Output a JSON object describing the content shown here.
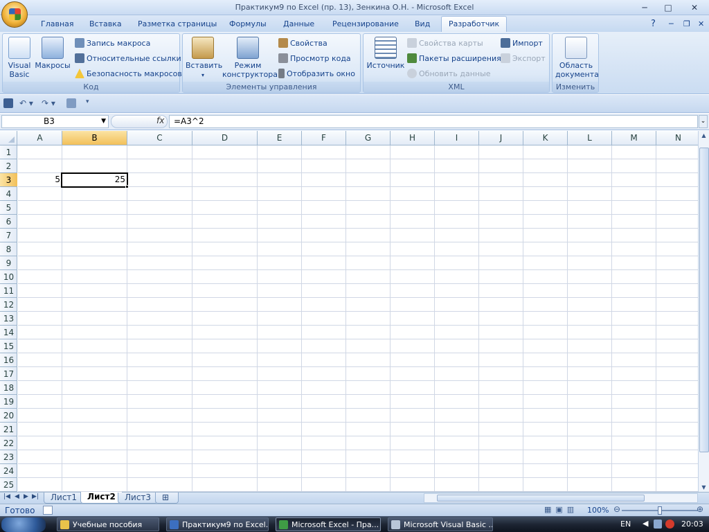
{
  "window": {
    "title": "Практикум9 по Excel (пр. 13), Зенкина О.Н. - Microsoft Excel",
    "minimize": "─",
    "maximize": "□",
    "close": "✕"
  },
  "tabs": [
    "Главная",
    "Вставка",
    "Разметка страницы",
    "Формулы",
    "Данные",
    "Рецензирование",
    "Вид",
    "Разработчик"
  ],
  "active_tab": "Разработчик",
  "ribbon": {
    "code": {
      "label": "Код",
      "visual_basic": "Visual Basic",
      "macros": "Макросы",
      "record_macro": "Запись макроса",
      "relative_refs": "Относительные ссылки",
      "macro_security": "Безопасность макросов"
    },
    "controls": {
      "label": "Элементы управления",
      "insert": "Вставить",
      "design_mode": "Режим конструктора",
      "properties": "Свойства",
      "view_code": "Просмотр кода",
      "run_dialog": "Отобразить окно"
    },
    "xml": {
      "label": "XML",
      "source": "Источник",
      "map_properties": "Свойства карты",
      "expansion_packs": "Пакеты расширения",
      "refresh_data": "Обновить данные",
      "import": "Импорт",
      "export": "Экспорт"
    },
    "modify": {
      "label": "Изменить",
      "document_panel": "Область документа"
    }
  },
  "formula_bar": {
    "name_box": "B3",
    "fx": "fx",
    "formula": "=A3^2"
  },
  "grid": {
    "columns": [
      "A",
      "B",
      "C",
      "D",
      "E",
      "F",
      "G",
      "H",
      "I",
      "J",
      "K",
      "L",
      "M",
      "N"
    ],
    "rows": [
      "1",
      "2",
      "3",
      "4",
      "5",
      "6",
      "7",
      "8",
      "9",
      "10",
      "11",
      "12",
      "13",
      "14",
      "15",
      "16",
      "17",
      "18",
      "19",
      "20",
      "21",
      "22",
      "23",
      "24",
      "25"
    ],
    "selected_col": "B",
    "selected_row": "3",
    "cells": {
      "A3": "5",
      "B3": "25"
    }
  },
  "sheets": [
    "Лист1",
    "Лист2",
    "Лист3"
  ],
  "active_sheet": "Лист2",
  "status": {
    "ready": "Готово",
    "zoom": "100%"
  },
  "taskbar": {
    "items": [
      "Учебные пособия",
      "Практикум9 по Excel...",
      "Microsoft Excel - Пра...",
      "Microsoft Visual Basic ..."
    ],
    "lang": "EN",
    "clock": "20:03"
  }
}
